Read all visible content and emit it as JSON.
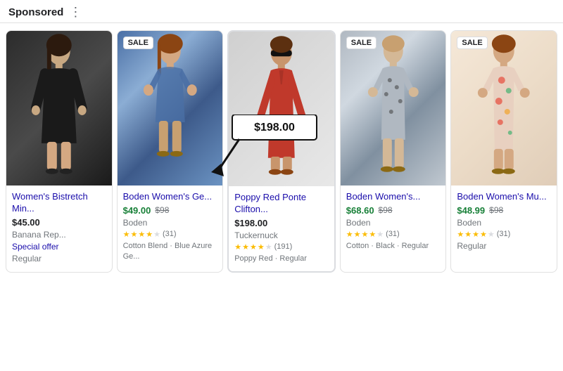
{
  "header": {
    "sponsored_label": "Sponsored",
    "more_options_icon": "⋮"
  },
  "products": [
    {
      "id": "p1",
      "title": "Women's Bistretch Min...",
      "price": "$45.00",
      "sale_price": null,
      "original_price": null,
      "seller": "Banana Rep...",
      "special_offer": "Special offer",
      "condition": "Regular",
      "has_sale_badge": false,
      "rating": 0,
      "review_count": null,
      "meta": null,
      "img_class": "img-black-dress"
    },
    {
      "id": "p2",
      "title": "Boden Women's Ge...",
      "price": "$49.00",
      "sale_price": "$49.00",
      "original_price": "$98",
      "seller": "Boden",
      "special_offer": null,
      "condition": null,
      "has_sale_badge": true,
      "rating": 3.5,
      "review_count": "(31)",
      "meta": "Cotton Blend · Blue Azure Ge...",
      "img_class": "img-blue-dress"
    },
    {
      "id": "p3",
      "title": "Poppy Red Ponte Clifton...",
      "price": "$198.00",
      "sale_price": null,
      "original_price": null,
      "seller": "Tuckernuck",
      "special_offer": null,
      "condition": null,
      "has_sale_badge": false,
      "rating": 4,
      "review_count": "(191)",
      "meta": "Poppy Red · Regular",
      "img_class": "img-red-dress"
    },
    {
      "id": "p4",
      "title": "Boden Women's...",
      "price": "$68.60",
      "sale_price": "$68.60",
      "original_price": "$98",
      "seller": "Boden",
      "special_offer": null,
      "condition": null,
      "has_sale_badge": true,
      "rating": 4,
      "review_count": "(31)",
      "meta": "Cotton · Black · Regular",
      "img_class": "img-patterned-dress"
    },
    {
      "id": "p5",
      "title": "Boden Women's Mu...",
      "price": "$48.99",
      "sale_price": "$48.99",
      "original_price": "$98",
      "seller": "Boden",
      "special_offer": null,
      "condition": "Regular",
      "has_sale_badge": true,
      "rating": 3.5,
      "review_count": "(31)",
      "meta": null,
      "img_class": "img-floral-dress"
    }
  ]
}
